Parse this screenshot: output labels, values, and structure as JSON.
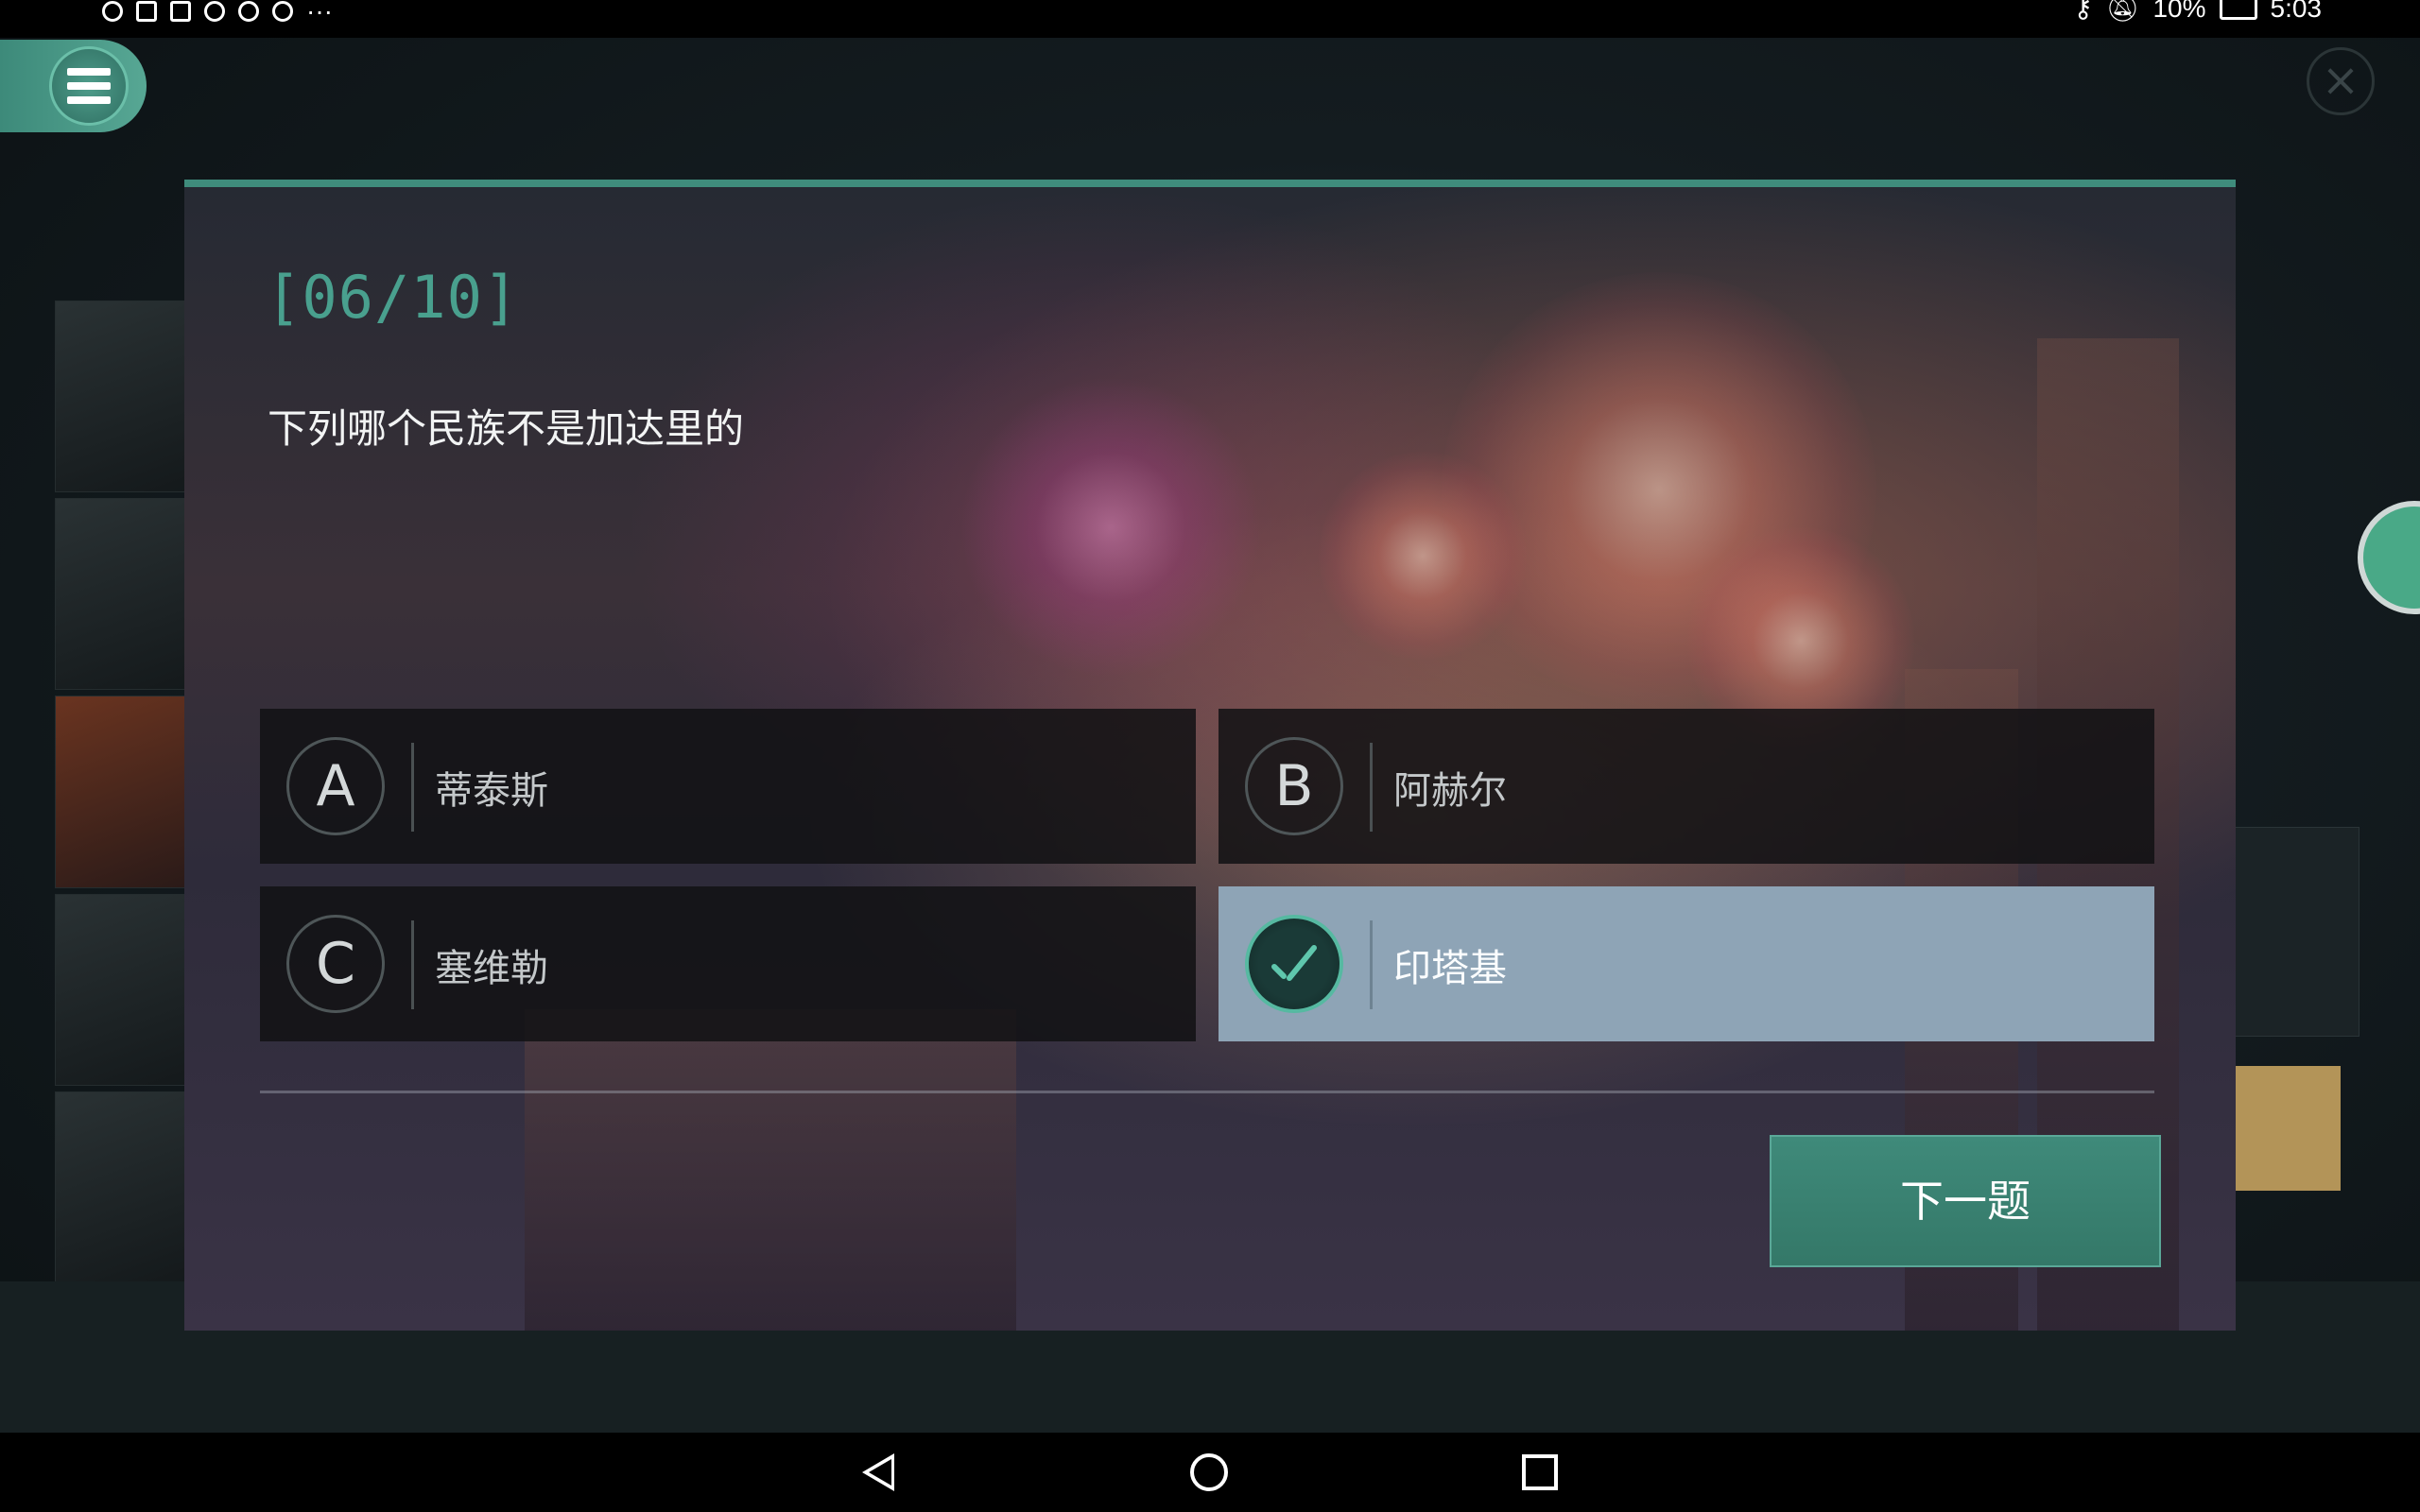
{
  "status_bar": {
    "battery_percent": "10%",
    "time": "5:03"
  },
  "dialog": {
    "progress": "[06/10]",
    "question": "下列哪个民族不是加达里的",
    "options": [
      {
        "letter": "A",
        "text": "蒂泰斯",
        "selected": false
      },
      {
        "letter": "B",
        "text": "阿赫尔",
        "selected": false
      },
      {
        "letter": "C",
        "text": "塞维勒",
        "selected": false
      },
      {
        "letter": "",
        "text": "印塔基",
        "selected": true
      }
    ],
    "next_button": "下一题"
  },
  "colors": {
    "accent": "#3f8c7c",
    "selected_option_bg": "#8ea4b6",
    "progress_text": "#49a08e"
  }
}
